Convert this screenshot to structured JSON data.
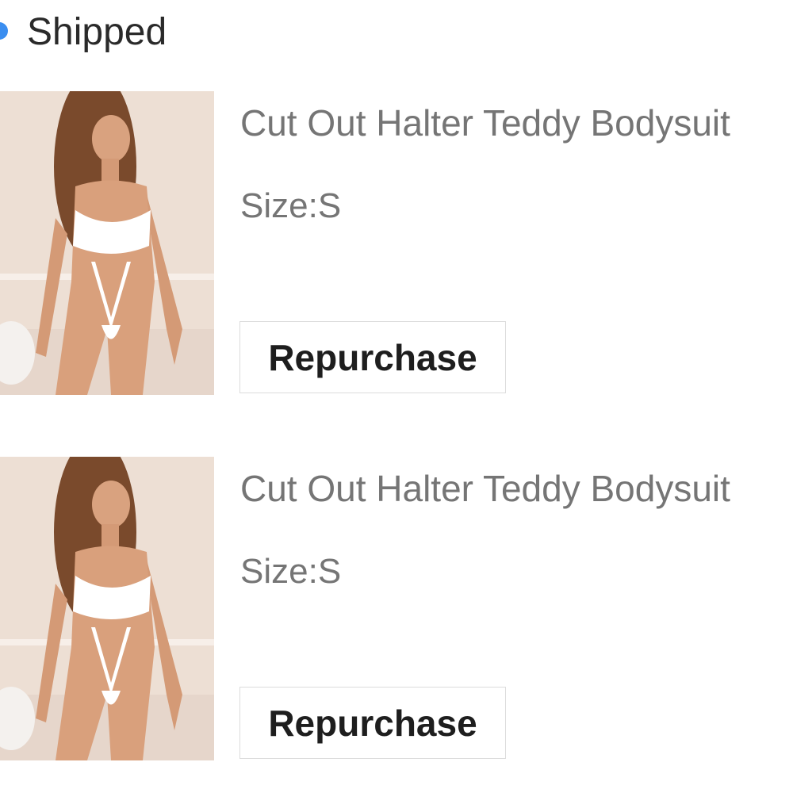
{
  "order": {
    "status_label": "Shipped",
    "status_color": "#3b8ef0"
  },
  "items": [
    {
      "title": "Cut Out Halter Teddy Bodysuit",
      "size_label": "Size:S",
      "action_label": "Repurchase"
    },
    {
      "title": "Cut Out Halter Teddy Bodysuit",
      "size_label": "Size:S",
      "action_label": "Repurchase"
    }
  ]
}
